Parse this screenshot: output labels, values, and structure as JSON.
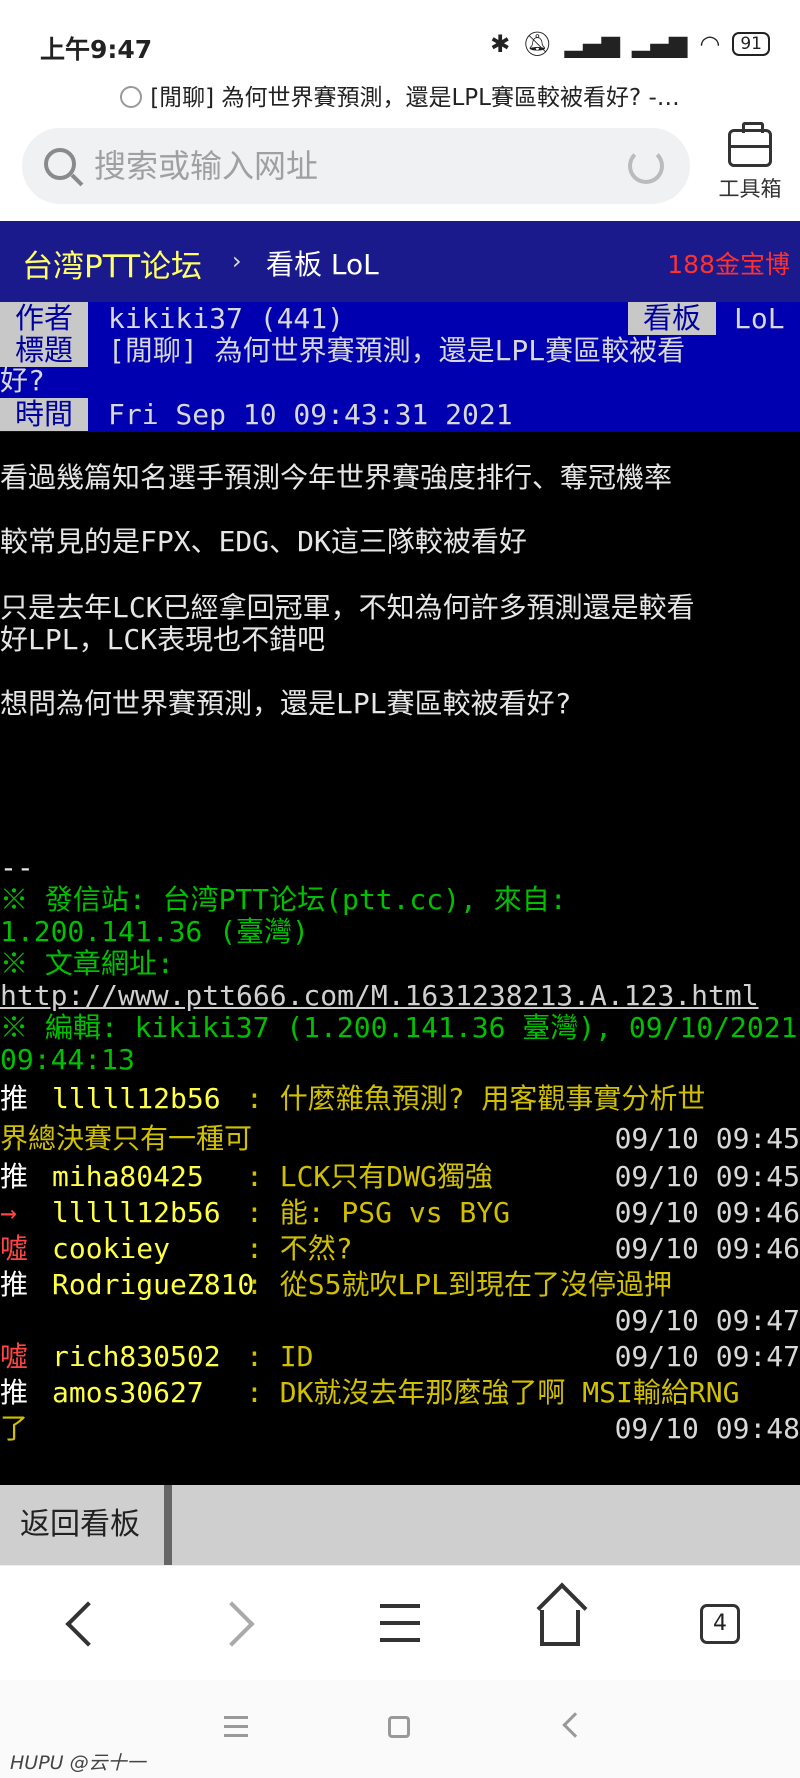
{
  "status": {
    "time": "上午9:47",
    "battery": "91"
  },
  "page_title": "[閒聊] 為何世界賽預測，還是LPL賽區較被看好? -…",
  "search": {
    "placeholder": "搜索或输入网址"
  },
  "toolbox_label": "工具箱",
  "ptt": {
    "site": "台湾PTT论坛",
    "separator": "›",
    "board": "看板 LoL",
    "ad": "188金宝博"
  },
  "meta": {
    "author_tag": "作者",
    "author": "kikiki37 (441)",
    "board_tag": "看板",
    "board": "LoL",
    "title_tag": "標題",
    "title_line1": "[閒聊] 為何世界賽預測，還是LPL賽區較被看",
    "title_line2": "好?",
    "time_tag": "時間",
    "time": "Fri Sep 10 09:43:31 2021"
  },
  "body": [
    "看過幾篇知名選手預測今年世界賽強度排行、奪冠機率",
    "較常見的是FPX、EDG、DK這三隊較被看好",
    "只是去年LCK已經拿回冠軍，不知為何許多預測還是較看",
    "好LPL，LCK表現也不錯吧",
    "想問為何世界賽預測，還是LPL賽區較被看好?"
  ],
  "sig": {
    "dashes": "--",
    "station1": "※ 發信站: 台湾PTT论坛(ptt.cc), 來自:",
    "station2": "1.200.141.36 (臺灣)",
    "url_label": "※ 文章網址:",
    "url": "http://www.ptt666.com/M.1631238213.A.123.html",
    "edit1": "※ 編輯: kikiki37 (1.200.141.36 臺灣), 09/10/2021",
    "edit2": "09:44:13"
  },
  "pushes": [
    {
      "tag": "推",
      "user": "lllll12b56",
      "content": ": 什麼雜魚預測? 用客觀事實分析世",
      "cont": "界總決賽只有一種可",
      "date": "09/10 09:45"
    },
    {
      "tag": "推",
      "user": "miha80425",
      "content": ": LCK只有DWG獨強",
      "date": "09/10 09:45"
    },
    {
      "tag": "→",
      "user": "lllll12b56",
      "content": ": 能: PSG vs BYG",
      "date": "09/10 09:46"
    },
    {
      "tag": "噓",
      "user": "cookiey",
      "content": ": 不然?",
      "date": "09/10 09:46"
    },
    {
      "tag": "推",
      "user": "RodrigueZ810",
      "content": ": 從S5就吹LPL到現在了沒停過押",
      "date": "09/10 09:47"
    },
    {
      "tag": "噓",
      "user": "rich830502",
      "content": ": ID",
      "date": "09/10 09:47"
    },
    {
      "tag": "推",
      "user": "amos30627",
      "content": ": DK就沒去年那麼強了啊 MSI輸給RNG",
      "cont": "了",
      "date": "09/10 09:48"
    }
  ],
  "back_label": "返回看板",
  "tab_count": "4",
  "watermark": "HUPU @云十一"
}
